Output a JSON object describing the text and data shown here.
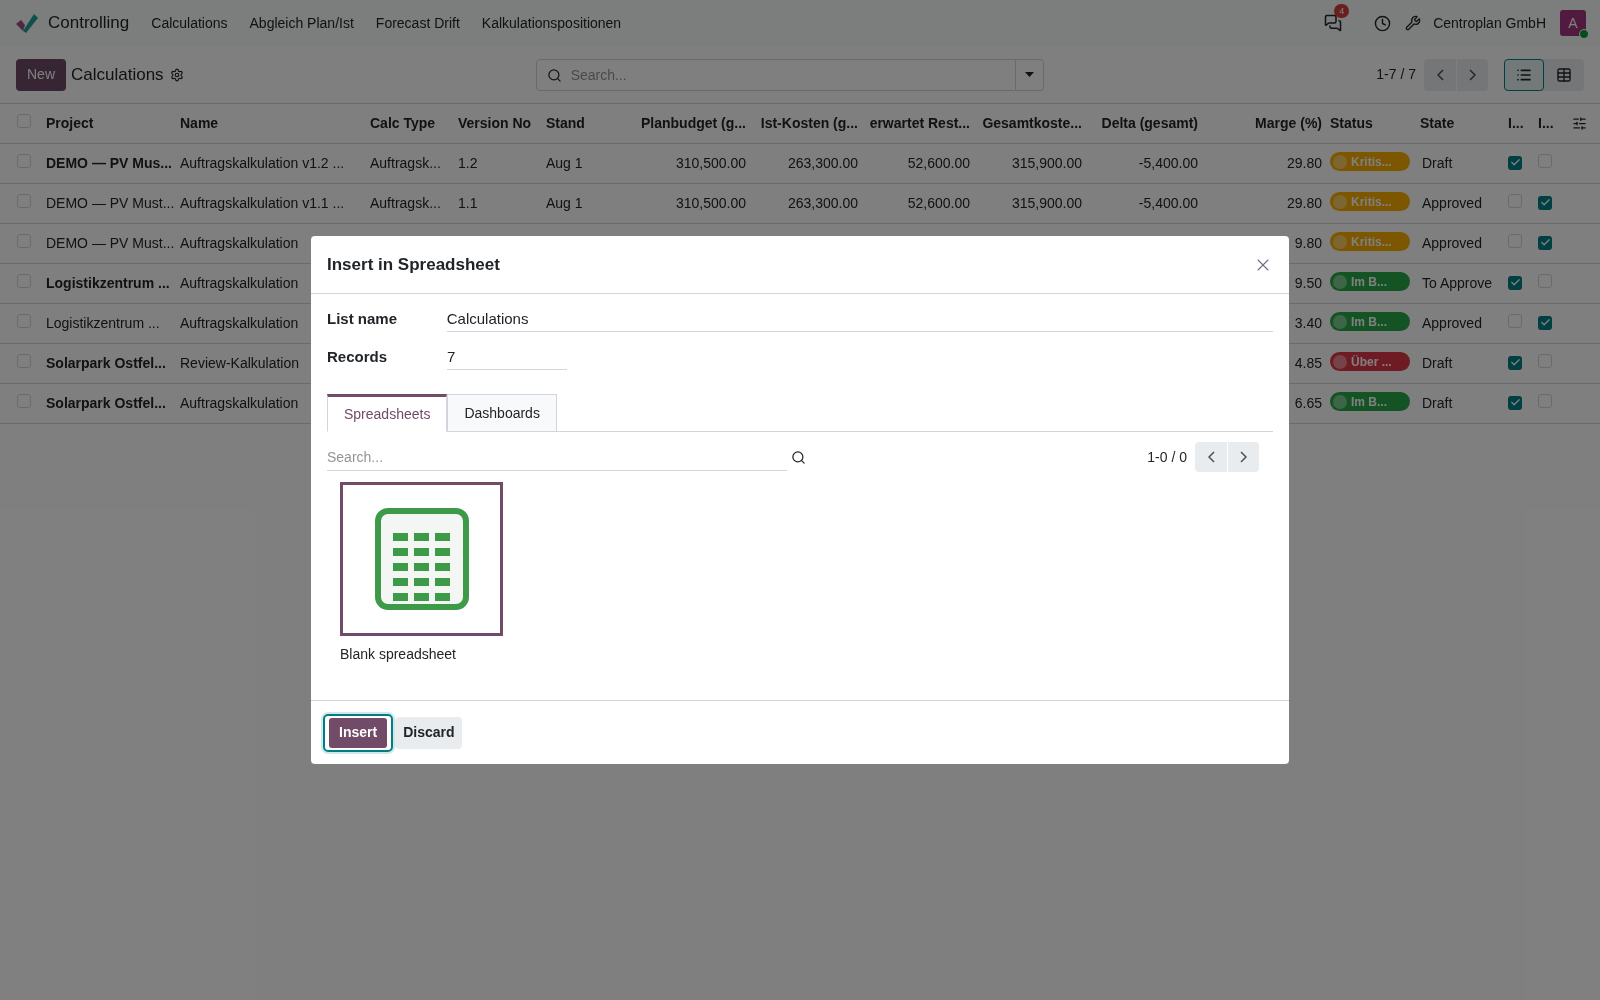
{
  "navbar": {
    "app_name": "Controlling",
    "menu": [
      "Calculations",
      "Abgleich Plan/Ist",
      "Forecast Drift",
      "Kalkulationspositionen"
    ],
    "messages_badge": "4",
    "company": "Centroplan GmbH",
    "avatar_letter": "A"
  },
  "control_panel": {
    "new_button": "New",
    "title": "Calculations",
    "search": {
      "placeholder": "Search..."
    },
    "pager": "1-7 / 7",
    "views": [
      {
        "kind": "list",
        "selected": true
      },
      {
        "kind": "pivot",
        "selected": false
      }
    ]
  },
  "table": {
    "columns": [
      "Project",
      "Name",
      "Calc Type",
      "Version No",
      "Stand",
      "Planbudget (g...",
      "Ist-Kosten (g...",
      "erwartet Rest...",
      "Gesamtkoste...",
      "Delta (gesamt)",
      "Marge (%)",
      "Status",
      "State",
      "I...",
      "I..."
    ],
    "select_all": false,
    "rows": [
      {
        "checked": false,
        "bold": true,
        "cells": [
          "DEMO — PV Mus...",
          "Auftragskalkulation v1.2 ...",
          "Auftragsk...",
          "1.2",
          "Aug 1",
          "310,500.00",
          "263,300.00",
          "52,600.00",
          "315,900.00",
          "-5,400.00",
          "29.80"
        ],
        "status": {
          "label": "Kritis...",
          "color": "#7d5600"
        },
        "state": "Draft",
        "flag_1": true,
        "flag_2": false
      },
      {
        "checked": false,
        "bold": false,
        "cells": [
          "DEMO — PV Must...",
          "Auftragskalkulation v1.1 ...",
          "Auftragsk...",
          "1.1",
          "Aug 1",
          "310,500.00",
          "263,300.00",
          "52,600.00",
          "315,900.00",
          "-5,400.00",
          "29.80"
        ],
        "status": {
          "label": "Kritis...",
          "color": "#7d5600"
        },
        "state": "Approved",
        "flag_1": false,
        "flag_2": true
      },
      {
        "checked": false,
        "bold": false,
        "cells": [
          "DEMO — PV Must...",
          "Auftragskalkulation",
          null,
          null,
          null,
          null,
          null,
          null,
          null,
          null,
          "9.80"
        ],
        "status": {
          "label": "Kritis...",
          "color": "#7d5600"
        },
        "state": "Approved",
        "flag_1": false,
        "flag_2": true
      },
      {
        "checked": false,
        "bold": true,
        "cells": [
          "Logistikzentrum ...",
          "Auftragskalkulation",
          null,
          null,
          null,
          null,
          null,
          null,
          null,
          null,
          "9.50"
        ],
        "status": {
          "label": "Im B...",
          "color": "#145424"
        },
        "state": "To Approve",
        "flag_1": true,
        "flag_2": false
      },
      {
        "checked": false,
        "bold": false,
        "cells": [
          "Logistikzentrum ...",
          "Auftragskalkulation",
          null,
          null,
          null,
          null,
          null,
          null,
          null,
          null,
          "3.40"
        ],
        "status": {
          "label": "Im B...",
          "color": "#145424"
        },
        "state": "Approved",
        "flag_1": false,
        "flag_2": true
      },
      {
        "checked": false,
        "bold": true,
        "cells": [
          "Solarpark Ostfel...",
          "Review-Kalkulation",
          null,
          null,
          null,
          null,
          null,
          null,
          null,
          null,
          "4.85"
        ],
        "status": {
          "label": "Über ...",
          "color": "#6e1b23"
        },
        "state": "Draft",
        "flag_1": true,
        "flag_2": false
      },
      {
        "checked": false,
        "bold": true,
        "cells": [
          "Solarpark Ostfel...",
          "Auftragskalkulation",
          null,
          null,
          null,
          null,
          null,
          null,
          null,
          null,
          "6.65"
        ],
        "status": {
          "label": "Im B...",
          "color": "#145424"
        },
        "state": "Draft",
        "flag_1": true,
        "flag_2": false
      }
    ]
  },
  "dialog": {
    "title": "Insert in Spreadsheet",
    "fields": [
      {
        "label": "List name",
        "value": "Calculations"
      },
      {
        "label": "Records",
        "value": "7"
      }
    ],
    "tabs": [
      {
        "label": "Spreadsheets",
        "selected": true
      },
      {
        "label": "Dashboards",
        "selected": false
      }
    ],
    "search": {
      "placeholder": "Search..."
    },
    "pager": "1-0 / 0",
    "cards": [
      {
        "label": "Blank spreadsheet",
        "selected": true
      }
    ],
    "buttons": [
      {
        "label": "Insert",
        "kind": "primary"
      },
      {
        "label": "Discard",
        "kind": "secondary"
      }
    ]
  }
}
